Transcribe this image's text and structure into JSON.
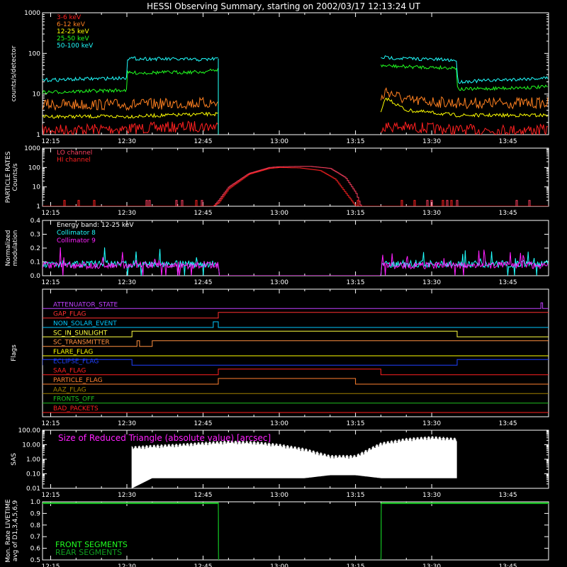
{
  "title": "HESSI Observing Summary, starting on 2002/03/17 12:13:24 UT",
  "time_axis": {
    "start": "12:13:24",
    "end": "13:53:00",
    "tick_labels": [
      "12:15",
      "12:30",
      "12:45",
      "13:00",
      "13:15",
      "13:30",
      "13:45"
    ]
  },
  "colors": {
    "background": "#000000",
    "axes": "#ffffff",
    "red": "#ff2020",
    "orange": "#ff8020",
    "yellow": "#ffff00",
    "green": "#20ff20",
    "cyan": "#20ffff",
    "magenta": "#ff20ff",
    "blue": "#2020ff",
    "lo_channel": "#ff4060",
    "hi_channel": "#ff2020"
  },
  "chart_data": [
    {
      "id": "counts",
      "type": "line",
      "ylabel": "counts/s/detector",
      "scale": "log",
      "ylim": [
        1,
        1000
      ],
      "y_tick_labels": [
        "1",
        "10",
        "100",
        "1000"
      ],
      "y_tick_values": [
        1,
        10,
        100,
        1000
      ],
      "series": [
        {
          "name": "3-6 keV",
          "color": "red",
          "segments": [
            {
              "x": [
                "12:13:24",
                "12:30",
                "12:44",
                "12:48"
              ],
              "y": [
                1.3,
                1.4,
                1.6,
                1.6
              ]
            },
            {
              "x": [
                "13:20",
                "13:27",
                "13:35",
                "13:53"
              ],
              "y": [
                1.6,
                1.5,
                1.3,
                1.3
              ]
            }
          ]
        },
        {
          "name": "6-12 keV",
          "color": "orange",
          "segments": [
            {
              "x": [
                "12:13:24",
                "12:30",
                "12:45",
                "12:48"
              ],
              "y": [
                5.5,
                5.5,
                6,
                6
              ]
            },
            {
              "x": [
                "13:20",
                "13:21",
                "13:25",
                "13:35",
                "13:53"
              ],
              "y": [
                7,
                12,
                7,
                6,
                6
              ]
            }
          ]
        },
        {
          "name": "12-25 keV",
          "color": "yellow",
          "segments": [
            {
              "x": [
                "12:13:24",
                "12:30",
                "12:45",
                "12:48"
              ],
              "y": [
                2.8,
                2.8,
                3.2,
                3.2
              ]
            },
            {
              "x": [
                "13:20",
                "13:21",
                "13:25",
                "13:35",
                "13:53"
              ],
              "y": [
                3.5,
                8,
                4,
                3,
                3
              ]
            }
          ]
        },
        {
          "name": "25-50 keV",
          "color": "green",
          "segments": [
            {
              "x": [
                "12:13:24",
                "12:29:55",
                "12:30:05",
                "12:45",
                "12:48"
              ],
              "y": [
                11,
                12.5,
                33,
                35,
                40
              ]
            },
            {
              "x": [
                "13:20",
                "13:25",
                "13:35",
                "13:35:05",
                "13:53"
              ],
              "y": [
                50,
                47,
                44,
                13,
                15
              ]
            }
          ]
        },
        {
          "name": "50-100 keV",
          "color": "cyan",
          "segments": [
            {
              "x": [
                "12:13:24",
                "12:29:55",
                "12:30:05",
                "12:45",
                "12:48"
              ],
              "y": [
                22,
                25,
                75,
                70,
                75
              ]
            },
            {
              "x": [
                "13:20",
                "13:25",
                "13:35",
                "13:35:05",
                "13:53"
              ],
              "y": [
                80,
                75,
                68,
                20,
                25
              ]
            }
          ]
        }
      ]
    },
    {
      "id": "particle",
      "type": "line",
      "ylabel": "PARTICLE RATES\nCounts/s",
      "scale": "log",
      "ylim": [
        1,
        1000
      ],
      "y_tick_labels": [
        "1",
        "10",
        "100",
        "1000"
      ],
      "y_tick_values": [
        1,
        10,
        100,
        1000
      ],
      "series": [
        {
          "name": "LO channel",
          "color": "lo_channel",
          "x": [
            "12:13:24",
            "12:47",
            "12:48",
            "12:50",
            "12:54",
            "12:58",
            "13:00",
            "13:06",
            "13:10",
            "13:13",
            "13:15",
            "13:16",
            "13:53"
          ],
          "y": [
            1,
            1,
            2,
            10,
            50,
            100,
            110,
            115,
            90,
            30,
            5,
            1,
            1
          ]
        },
        {
          "name": "HI channel",
          "color": "hi_channel",
          "x": [
            "12:13:24",
            "12:47",
            "12:48",
            "12:50",
            "12:54",
            "12:58",
            "13:00",
            "13:04",
            "13:08",
            "13:11",
            "13:13",
            "13:15",
            "13:53"
          ],
          "y": [
            1,
            1,
            1.5,
            8,
            45,
            90,
            100,
            95,
            70,
            25,
            5,
            1,
            1
          ]
        }
      ]
    },
    {
      "id": "modulation",
      "type": "line",
      "ylabel": "Normalized\nmodulation",
      "ylim": [
        0,
        0.4
      ],
      "y_tick_labels": [
        "0.0",
        "0.1",
        "0.2",
        "0.3",
        "0.4"
      ],
      "y_tick_values": [
        0,
        0.1,
        0.2,
        0.3,
        0.4
      ],
      "energy_band": "Energy band: 12-25 keV",
      "series": [
        {
          "name": "Collimator 8",
          "color": "cyan",
          "x": [
            "12:13:24",
            "12:48",
            "12:48:10",
            "13:20",
            "13:20:10",
            "13:53"
          ],
          "y": [
            0.08,
            0.08,
            0,
            0,
            0.08,
            0.08
          ]
        },
        {
          "name": "Collimator 9",
          "color": "magenta",
          "x": [
            "12:13:24",
            "12:48",
            "12:48:10",
            "13:20",
            "13:20:10",
            "13:53"
          ],
          "y": [
            0.07,
            0.07,
            0,
            0,
            0.07,
            0.07
          ]
        }
      ]
    },
    {
      "id": "flags",
      "type": "line",
      "ylabel": "Flags",
      "series": [
        {
          "name": "ATTENUATOR_STATE",
          "color": "#c040ff",
          "transitions": [
            [
              "13:51:30",
              1
            ],
            [
              "13:51:50",
              0
            ]
          ]
        },
        {
          "name": "GAP_FLAG",
          "color": "#ff3030",
          "transitions": [
            [
              "12:48",
              1
            ]
          ]
        },
        {
          "name": "NON_SOLAR_EVENT",
          "color": "#00c8ff",
          "transitions": [
            [
              "12:47",
              1
            ],
            [
              "12:48",
              0
            ]
          ]
        },
        {
          "name": "SC_IN_SUNLIGHT",
          "color": "#ffff40",
          "transitions": [
            [
              "12:31",
              1
            ],
            [
              "13:35",
              0
            ]
          ]
        },
        {
          "name": "SC_TRANSMITTER",
          "color": "#ff9040",
          "transitions": [
            [
              "12:32",
              1
            ],
            [
              "12:32:30",
              0
            ],
            [
              "12:35",
              1
            ]
          ]
        },
        {
          "name": "FLARE_FLAG",
          "color": "#ffff00",
          "transitions": []
        },
        {
          "name": "ECLIPSE_FLAG",
          "color": "#2040ff",
          "transitions": [
            [
              "12:13:24",
              1
            ],
            [
              "12:31",
              0
            ],
            [
              "13:35",
              1
            ]
          ]
        },
        {
          "name": "SAA_FLAG",
          "color": "#ff2020",
          "transitions": [
            [
              "12:48",
              1
            ],
            [
              "13:20",
              0
            ]
          ]
        },
        {
          "name": "PARTICLE_FLAG",
          "color": "#ff8030",
          "transitions": [
            [
              "12:48",
              1
            ],
            [
              "13:15",
              0
            ]
          ]
        },
        {
          "name": "AAZ_FLAG",
          "color": "#a08000",
          "transitions": []
        },
        {
          "name": "FRONTS_OFF",
          "color": "#20c020",
          "transitions": []
        },
        {
          "name": "BAD_PACKETS",
          "color": "#ff2020",
          "transitions": []
        }
      ]
    },
    {
      "id": "sas",
      "type": "area",
      "ylabel": "SAS",
      "scale": "log",
      "ylim": [
        0.01,
        100
      ],
      "y_tick_labels": [
        "0.01",
        "0.10",
        "1.00",
        "10.00",
        "100.00"
      ],
      "y_tick_values": [
        0.01,
        0.1,
        1,
        10,
        100
      ],
      "caption": "Size of Reduced Triangle (absolute value) [arcsec]",
      "series": [
        {
          "name": "Size of Reduced Triangle",
          "color": "#ffffff",
          "x": [
            "12:31",
            "12:35",
            "12:40",
            "12:45",
            "12:50",
            "12:55",
            "13:00",
            "13:05",
            "13:10",
            "13:15",
            "13:20",
            "13:25",
            "13:30",
            "13:35"
          ],
          "y_high": [
            8,
            10,
            12,
            16,
            20,
            18,
            12,
            6,
            2,
            2,
            15,
            30,
            40,
            30
          ],
          "y_low": [
            0.01,
            0.05,
            0.05,
            0.05,
            0.05,
            0.05,
            0.05,
            0.05,
            0.08,
            0.08,
            0.05,
            0.05,
            0.05,
            0.05
          ]
        }
      ]
    },
    {
      "id": "livetime",
      "type": "line",
      "ylabel": "Mon. Rate LIVETIME\navg of D1,3,4,5,6,9",
      "ylim": [
        0.5,
        1.0
      ],
      "y_tick_labels": [
        "0.5",
        "0.6",
        "0.7",
        "0.8",
        "0.9",
        "1.0"
      ],
      "y_tick_values": [
        0.5,
        0.6,
        0.7,
        0.8,
        0.9,
        1.0
      ],
      "series": [
        {
          "name": "FRONT SEGMENTS",
          "color": "#20ff20",
          "x": [
            "12:13:24",
            "12:48",
            "12:48:05",
            "13:20",
            "13:20:05",
            "13:53"
          ],
          "y": [
            0.99,
            0.99,
            0.3,
            0.3,
            0.99,
            0.99
          ]
        },
        {
          "name": "REAR SEGMENTS",
          "color": "#10a020",
          "x": [
            "12:13:24",
            "12:48",
            "12:48:05",
            "13:20",
            "13:20:05",
            "13:53"
          ],
          "y": [
            0.985,
            0.985,
            0.3,
            0.3,
            0.985,
            0.985
          ]
        }
      ]
    }
  ]
}
